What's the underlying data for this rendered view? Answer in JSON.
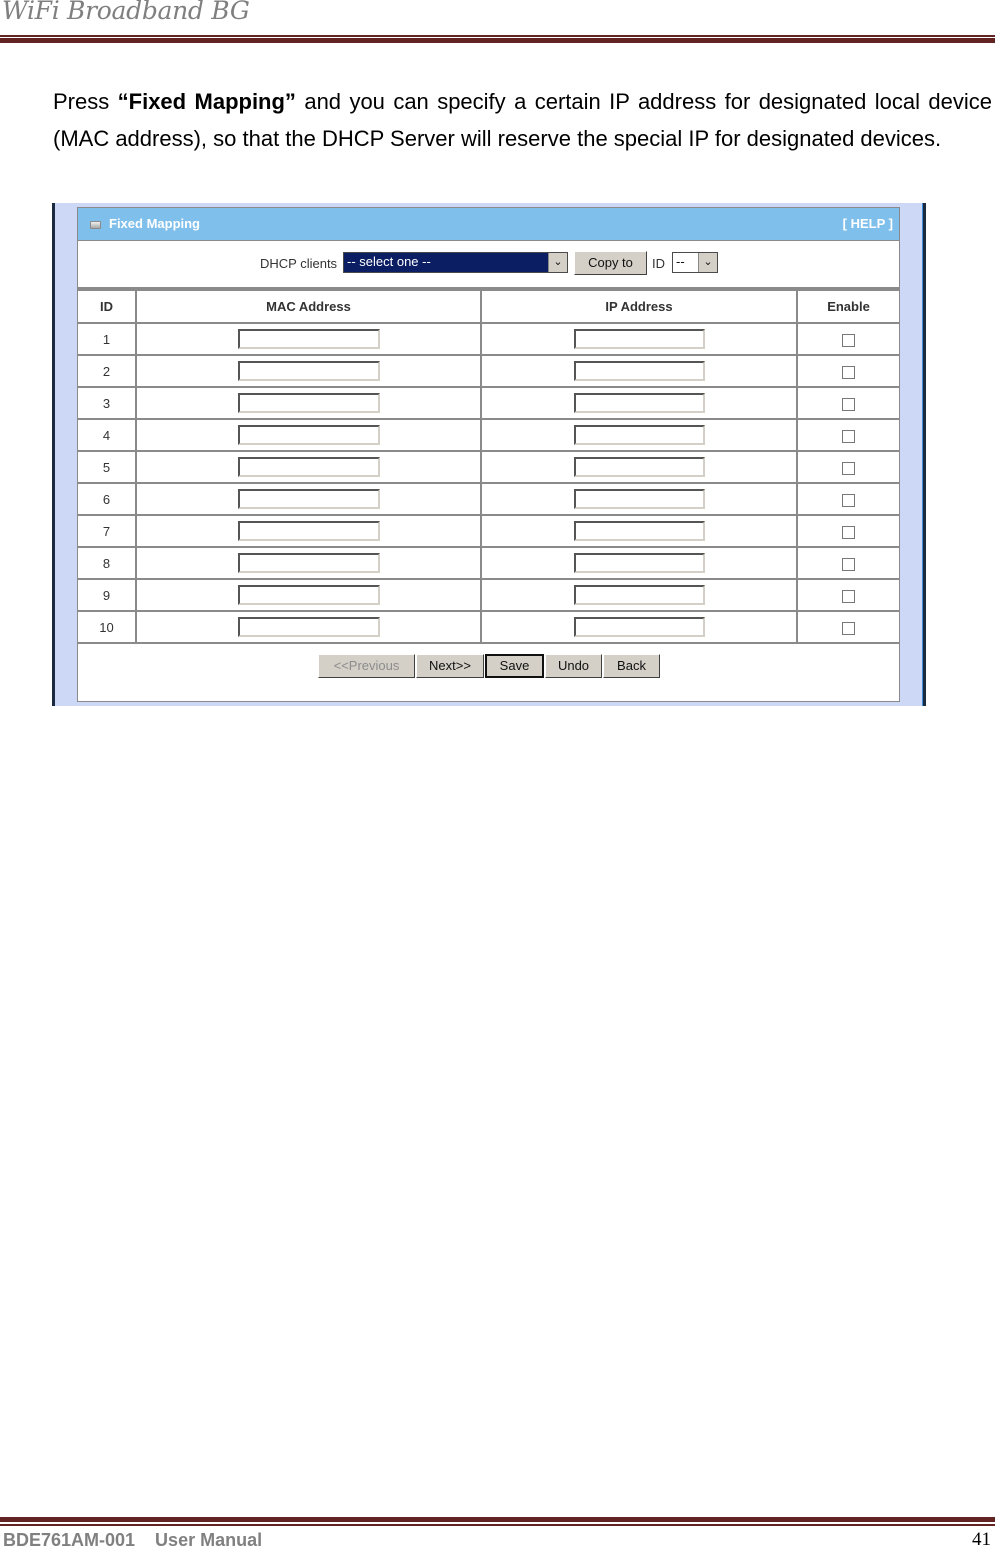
{
  "header": {
    "title": "WiFi Broadband BG"
  },
  "body": {
    "paragraph_prefix": "Press ",
    "paragraph_bold": "“Fixed Mapping”",
    "paragraph_suffix": " and you can specify a certain IP address for designated local device (MAC address), so that the DHCP Server will reserve the special IP for designated devices."
  },
  "panel": {
    "icon": "panel-bullet-icon",
    "title": "Fixed Mapping",
    "help_link": "[ HELP ]",
    "dhcp_clients_label": "DHCP clients",
    "dhcp_clients_selected": "-- select one --",
    "copy_to_button": "Copy to",
    "id_label": "ID",
    "id_selected": "--",
    "dropdown_arrow": "⌄",
    "columns": [
      "ID",
      "MAC Address",
      "IP Address",
      "Enable"
    ],
    "rows": [
      {
        "id": "1",
        "mac": "",
        "ip": "",
        "enabled": false
      },
      {
        "id": "2",
        "mac": "",
        "ip": "",
        "enabled": false
      },
      {
        "id": "3",
        "mac": "",
        "ip": "",
        "enabled": false
      },
      {
        "id": "4",
        "mac": "",
        "ip": "",
        "enabled": false
      },
      {
        "id": "5",
        "mac": "",
        "ip": "",
        "enabled": false
      },
      {
        "id": "6",
        "mac": "",
        "ip": "",
        "enabled": false
      },
      {
        "id": "7",
        "mac": "",
        "ip": "",
        "enabled": false
      },
      {
        "id": "8",
        "mac": "",
        "ip": "",
        "enabled": false
      },
      {
        "id": "9",
        "mac": "",
        "ip": "",
        "enabled": false
      },
      {
        "id": "10",
        "mac": "",
        "ip": "",
        "enabled": false
      }
    ],
    "buttons": {
      "previous": "<<Previous",
      "next": "Next>>",
      "save": "Save",
      "undo": "Undo",
      "back": "Back"
    }
  },
  "footer": {
    "doc_id": "BDE761AM-001    User Manual",
    "page_number": "41"
  },
  "colors": {
    "rule": "#622423",
    "panel_header": "#7fbfeb",
    "select_highlight": "#0b1e63",
    "frame_bg": "#cdd7f6"
  }
}
